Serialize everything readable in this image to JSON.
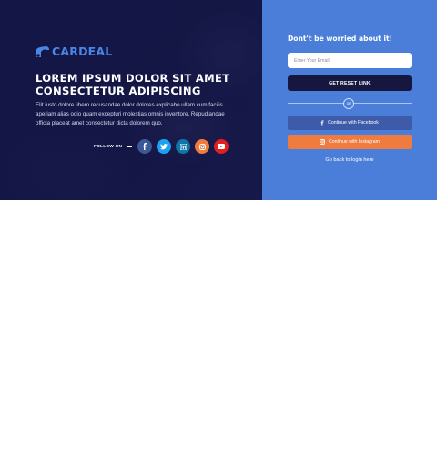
{
  "brand": {
    "name": "CARDEAL",
    "color": "#4a86e8"
  },
  "hero": {
    "headline": "LOREM IPSUM DOLOR SIT AMET CONSECTETUR ADIPISCING",
    "description": "Elit iusto dolore libero recusandae dolor dolores explicabo ullam cum facilis aperiam alias odio quam excepturi molestias omnis inventore. Repudiandae officia placeat amet consectetur dicta dolorem quo."
  },
  "follow": {
    "label": "FOLLOW ON",
    "socials": [
      {
        "name": "facebook",
        "icon": "facebook-icon",
        "color": "#3b5998"
      },
      {
        "name": "twitter",
        "icon": "twitter-icon",
        "color": "#1da1f2"
      },
      {
        "name": "linkedin",
        "icon": "linkedin-icon",
        "color": "#0e76a8"
      },
      {
        "name": "instagram",
        "icon": "instagram-icon",
        "color": "#ef7b3e"
      },
      {
        "name": "youtube",
        "icon": "youtube-icon",
        "color": "#e02020"
      }
    ]
  },
  "reset_form": {
    "title": "Dont't be worried about it!",
    "email_placeholder": "Enter Your Email",
    "email_value": "",
    "submit_label": "GET RESET LINK",
    "divider_label": "or",
    "facebook_label": "Continue with Facebook",
    "instagram_label": "Continue with Instagram",
    "back_label": "Go back to login here"
  },
  "colors": {
    "left_bg": "#15173f",
    "right_bg": "#4a7ed9",
    "reset_button": "#15173f",
    "facebook_button": "#3d5ba9",
    "instagram_button": "#ef7b3e"
  }
}
